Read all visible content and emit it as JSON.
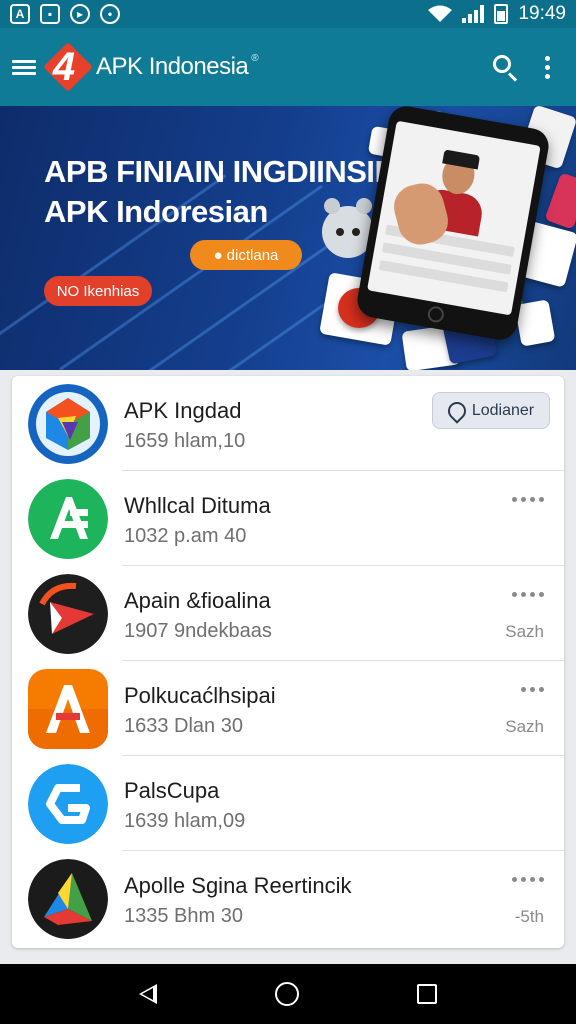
{
  "status_bar": {
    "time": "19:49",
    "icons": [
      "app-a-icon",
      "photo-icon",
      "video-icon",
      "chat-icon"
    ],
    "signal_icon": "cell-signal-icon",
    "wifi_icon": "wifi-icon",
    "battery_icon": "battery-icon"
  },
  "app_bar": {
    "menu_icon": "menu-icon",
    "logo_glyph": "4",
    "brand": "APK Indonesia",
    "brand_mark": "®",
    "search_icon": "search-icon",
    "more_icon": "more-vert-icon"
  },
  "banner": {
    "title_line1": "APB FINIAIN INGDIINSIE",
    "title_line2": "APK Indoresian",
    "orange_button": "dictlana",
    "red_button": "NO Ikenhias",
    "accent_orange": "#f08a1c",
    "accent_red": "#e2402b"
  },
  "apps": [
    {
      "name": "APK Ingdad",
      "meta": "1659 hlam,10",
      "action_label": "Lodianer",
      "action_icon": "location-pin-icon",
      "icon": "colorful-cube-icon"
    },
    {
      "name": "Whllcal Dituma",
      "meta": "1032 p.am 40",
      "icon": "green-a-icon"
    },
    {
      "name": "Apain &fioalina",
      "meta": "1907 9ndekbaas",
      "side": "Sazh",
      "icon": "red-arrow-icon"
    },
    {
      "name": "Polkucaćlhsipai",
      "meta": "1633 Dlan 30",
      "side": "Sazh",
      "icon": "orange-a-icon"
    },
    {
      "name": "PalsCupa",
      "meta": "1639 hlam,09",
      "icon": "blue-g-icon"
    },
    {
      "name": "Apolle Sgina Reertincik",
      "meta": "1335 Bhm 30",
      "side": "-5th",
      "icon": "triangle-prism-icon"
    }
  ],
  "nav_bar": {
    "back_icon": "back-icon",
    "home_icon": "home-icon",
    "recents_icon": "recents-icon"
  }
}
